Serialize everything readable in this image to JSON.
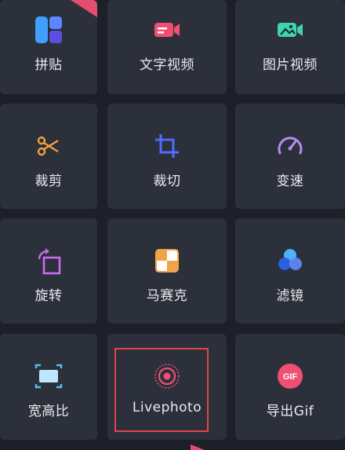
{
  "tiles": [
    {
      "label": "拼贴",
      "icon": "collage-icon"
    },
    {
      "label": "文字视频",
      "icon": "text-video-icon"
    },
    {
      "label": "图片视频",
      "icon": "photo-video-icon"
    },
    {
      "label": "裁剪",
      "icon": "scissors-icon"
    },
    {
      "label": "裁切",
      "icon": "crop-icon"
    },
    {
      "label": "变速",
      "icon": "speedometer-icon"
    },
    {
      "label": "旋转",
      "icon": "rotate-icon"
    },
    {
      "label": "马赛克",
      "icon": "mosaic-icon"
    },
    {
      "label": "滤镜",
      "icon": "filter-icon"
    },
    {
      "label": "宽高比",
      "icon": "aspect-ratio-icon"
    },
    {
      "label": "Livephoto",
      "icon": "livephoto-icon"
    },
    {
      "label": "导出Gif",
      "icon": "gif-icon",
      "badge": "GIF"
    }
  ],
  "colors": {
    "background": "#1d2028",
    "tile": "#2c303a",
    "highlight": "#e2444a",
    "accent_pink": "#e54c6d"
  }
}
